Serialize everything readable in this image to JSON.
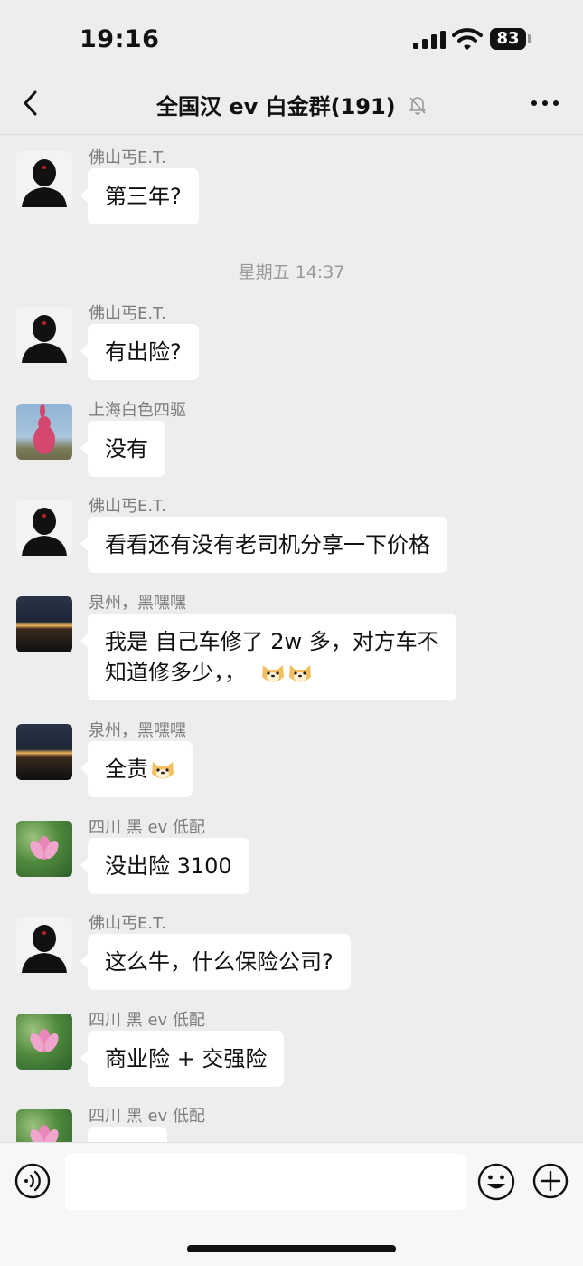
{
  "status_bar": {
    "time": "19:16",
    "battery": "83"
  },
  "header": {
    "title": "全国汉 ev 白金群(191)"
  },
  "icons": {
    "back": "chevron-left-icon",
    "mute": "bell-slash-icon",
    "more": "more-dots-icon",
    "voice": "voice-icon",
    "emoji": "smiley-icon",
    "plus": "plus-icon",
    "dog_emoji": "dog-face-emoji-icon"
  },
  "messages": [
    {
      "sender": "佛山丐E.T.",
      "text": "第三年?"
    },
    {
      "sender": "佛山丐E.T.",
      "text": "有出险?"
    },
    {
      "sender": "上海白色四驱",
      "text": "没有"
    },
    {
      "sender": "佛山丐E.T.",
      "text": "看看还有没有老司机分享一下价格"
    },
    {
      "sender": "泉州，黑嘿嘿",
      "text_line1": "我是 自己车修了 2w 多，对方车不",
      "text_line2": "知道修多少，，"
    },
    {
      "sender": "泉州，黑嘿嘿",
      "text": "全责"
    },
    {
      "sender": "四川 黑  ev 低配",
      "text": "没出险  3100"
    },
    {
      "sender": "佛山丐E.T.",
      "text": "这么牛，什么保险公司?"
    },
    {
      "sender": "四川 黑  ev 低配",
      "text": "商业险 + 交强险"
    },
    {
      "sender": "四川 黑  ev 低配"
    }
  ],
  "timestamp": "星期五 14:37",
  "colors": {
    "background": "#ededed",
    "bubble": "#ffffff",
    "sender": "#7d7d7d",
    "timestamp": "#9a9a9a"
  }
}
